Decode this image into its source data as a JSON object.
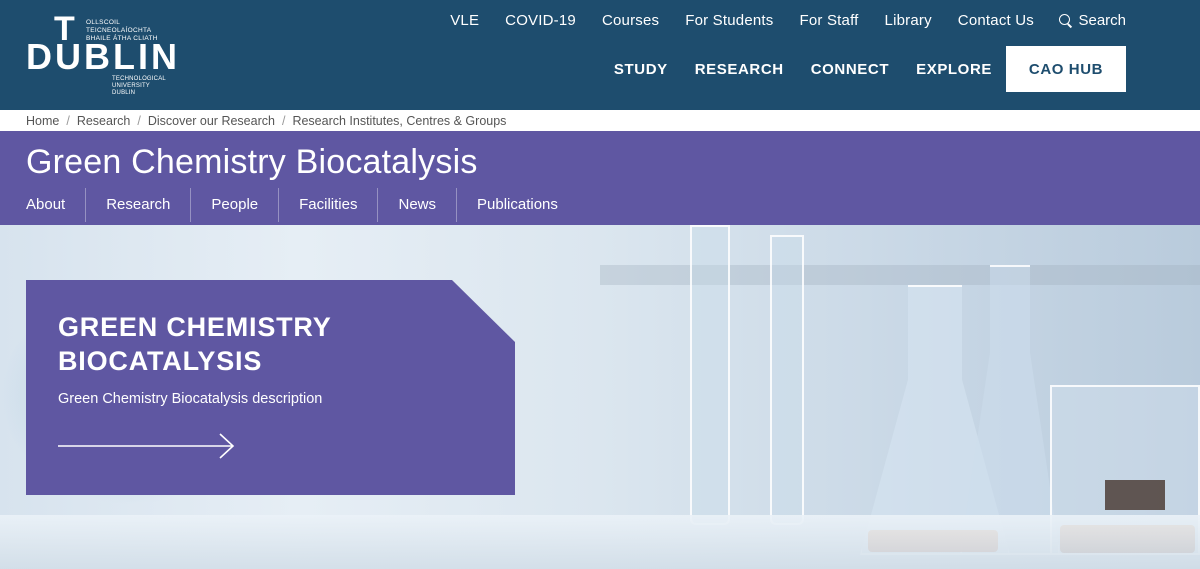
{
  "logo": {
    "t": "T",
    "dublin": "DUBLIN",
    "irish_line1": "OLLSCOIL TEICNEOLAÍOCHTA",
    "irish_line2": "BHAILE ÁTHA CLIATH",
    "english_line1": "TECHNOLOGICAL",
    "english_line2": "UNIVERSITY DUBLIN"
  },
  "topnav": [
    "VLE",
    "COVID-19",
    "Courses",
    "For Students",
    "For Staff",
    "Library",
    "Contact Us"
  ],
  "search_label": "Search",
  "mainnav": [
    "STUDY",
    "RESEARCH",
    "CONNECT",
    "EXPLORE"
  ],
  "cao_label": "CAO HUB",
  "breadcrumb": [
    "Home",
    "Research",
    "Discover our Research",
    "Research Institutes, Centres & Groups"
  ],
  "section": {
    "title": "Green Chemistry Biocatalysis",
    "tabs": [
      "About",
      "Research",
      "People",
      "Facilities",
      "News",
      "Publications"
    ]
  },
  "hero": {
    "title": "GREEN CHEMISTRY BIOCATALYSIS",
    "description": "Green Chemistry Biocatalysis description"
  },
  "colors": {
    "header_bg": "#1e4d6e",
    "accent_purple": "#5f57a2",
    "white": "#ffffff"
  }
}
